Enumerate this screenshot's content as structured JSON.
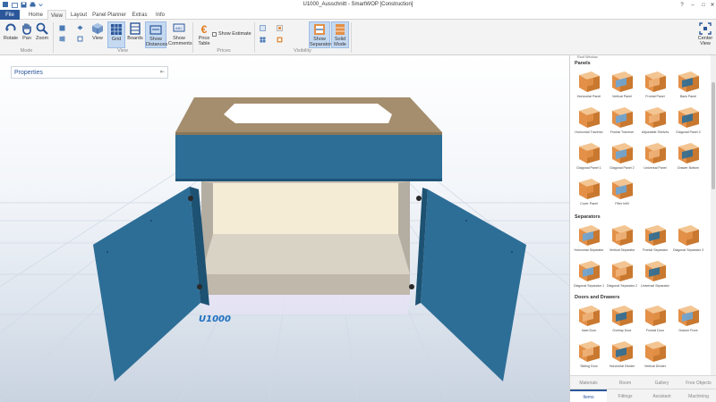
{
  "window": {
    "title": "U1000_Ausschnitt - SmartWOP [Construction]",
    "minimize_glyph": "–",
    "maximize_glyph": "□",
    "close_glyph": "✕",
    "help_glyph": "?"
  },
  "tabs": [
    "File",
    "Home",
    "View",
    "Layout",
    "Panel Planner",
    "Extras",
    "Info"
  ],
  "ribbon": {
    "mode": {
      "label": "Mode",
      "buttons": [
        "Rotate",
        "Pan",
        "Zoom"
      ]
    },
    "view": {
      "label": "View",
      "buttons": [
        "View",
        "Grid",
        "Boards",
        "Show Distances",
        "Show Comments"
      ]
    },
    "prices": {
      "label": "Prices",
      "price_table": "Price Table",
      "show_estimate": "Show Estimate"
    },
    "visibility": {
      "label": "Visibility",
      "show_separators": "Show Separators",
      "solid_mode": "Solid Mode"
    },
    "center_view": "Center View"
  },
  "properties": {
    "title": "Properties",
    "pin_glyph": "⇤"
  },
  "cabinet_label": "U1000",
  "panel": {
    "top_caption": "Roof Window",
    "sections": [
      {
        "title": "Panels",
        "items": [
          "Horizontal Panel",
          "Vertical Panel",
          "Frontal Panel",
          "Back Panel",
          "Horizontal Traverse",
          "Frontal Traverse",
          "Adjustable Shelves",
          "Diagonal Panel 3",
          "Diagonal Panel 1",
          "Diagonal Panel 2",
          "Universal Panel",
          "Drawer Bottom",
          "Cover Panel",
          "Filler Infill"
        ]
      },
      {
        "title": "Separators",
        "items": [
          "Horizontal Separator",
          "Vertical Separator",
          "Frontal Separator",
          "Diagonal Separator 3",
          "Diagonal Separator 1",
          "Diagonal Separator 2",
          "Universal Separator"
        ]
      },
      {
        "title": "Doors and Drawers",
        "items": [
          "Inset Door",
          "Overlay Door",
          "Frontal Door",
          "Drawer Front",
          "Sliding Door",
          "Horizontal Divider",
          "Vertical Divider"
        ]
      }
    ],
    "bottom_tabs_row1": [
      "Materials",
      "Room",
      "Gallery",
      "Free Objects"
    ],
    "bottom_tabs_row2": [
      "Items",
      "Fittings",
      "Assistant",
      "Machining"
    ]
  },
  "colors": {
    "accent": "#2b579a",
    "cabinet_blue": "#2a6a8f",
    "cabinet_front": "#2d6e97",
    "wood": "#a48e6e",
    "panel_orange": "#e39048"
  }
}
